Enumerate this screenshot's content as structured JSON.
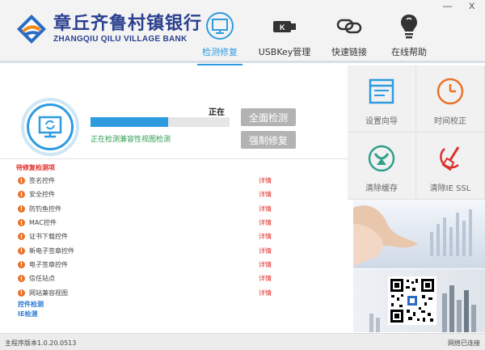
{
  "header": {
    "bank_name_cn": "章丘齐鲁村镇银行",
    "bank_name_en": "ZHANGQIU QILU VILLAGE BANK",
    "tabs": [
      {
        "label": "检测修复",
        "icon": "monitor-refresh-icon",
        "active": true
      },
      {
        "label": "USBKey管理",
        "icon": "usbkey-icon",
        "active": false
      },
      {
        "label": "快速链接",
        "icon": "link-icon",
        "active": false
      },
      {
        "label": "在线帮助",
        "icon": "lightbulb-icon",
        "active": false
      }
    ],
    "minimize": "—",
    "close": "X"
  },
  "scan": {
    "progress_percent": 56,
    "status_right": "正在",
    "status_text": "正在检测兼容性视图检测",
    "full_check_button": "全面检测",
    "force_repair_button": "强制修复"
  },
  "list": {
    "title": "待修复检测项",
    "items": [
      {
        "label": "签名控件",
        "action": "详情"
      },
      {
        "label": "安全控件",
        "action": "详情"
      },
      {
        "label": "防钓鱼控件",
        "action": "详情"
      },
      {
        "label": "MAC控件",
        "action": "详情"
      },
      {
        "label": "证书下载控件",
        "action": "详情"
      },
      {
        "label": "新电子签章控件",
        "action": "详情"
      },
      {
        "label": "电子签章控件",
        "action": "详情"
      },
      {
        "label": "信任站点",
        "action": "详情"
      },
      {
        "label": "网站兼容视图",
        "action": "详情"
      }
    ],
    "extra_links": [
      "控件检测",
      "IE检测"
    ]
  },
  "tiles": [
    {
      "label": "设置向导",
      "icon": "settings-wizard-icon"
    },
    {
      "label": "时间校正",
      "icon": "clock-icon"
    },
    {
      "label": "清除缓存",
      "icon": "clear-cache-icon"
    },
    {
      "label": "清除IE SSL",
      "icon": "broom-icon"
    }
  ],
  "statusbar": {
    "version": "主程序版本1.0.20.0513",
    "network": "网络已连接"
  },
  "colors": {
    "accent": "#2e9be0",
    "brand": "#2a3f8f",
    "warning": "#e8732b",
    "danger": "#e2302d"
  }
}
